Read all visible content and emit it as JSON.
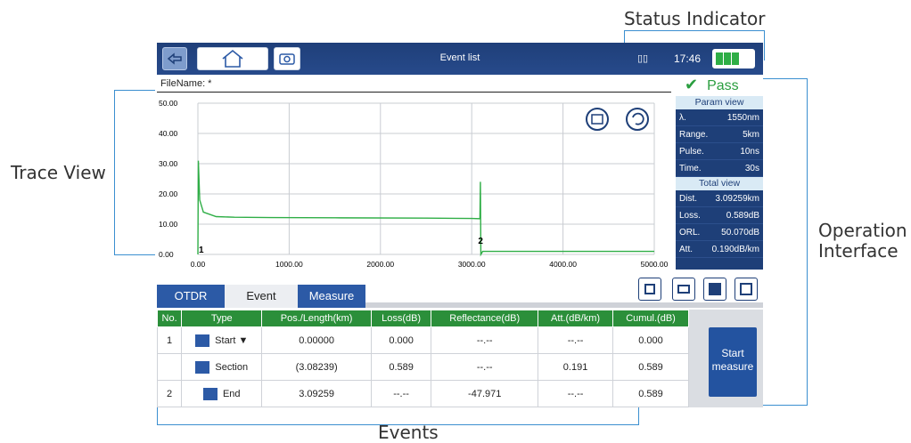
{
  "callouts": {
    "status": "Status Indicator",
    "trace": "Trace View",
    "operation_1": "Operation",
    "operation_2": "Interface",
    "events": "Events"
  },
  "titlebar": {
    "title": "Event list",
    "time": "17:46"
  },
  "file": {
    "label": "FileName: *"
  },
  "result": {
    "label": "Pass",
    "color": "#2a9e3f"
  },
  "chart_data": {
    "type": "line",
    "xlim": [
      0,
      5000
    ],
    "ylim": [
      0,
      50
    ],
    "x_ticks": [
      "0.00",
      "1000.00",
      "2000.00",
      "3000.00",
      "4000.00",
      "5000.00"
    ],
    "y_ticks": [
      "50.00",
      "40.00",
      "30.00",
      "20.00",
      "10.00",
      "0.00"
    ],
    "series": [
      {
        "values_x": [
          0,
          5,
          20,
          60,
          200,
          400,
          800,
          1500,
          2500,
          3000,
          3090,
          3095,
          3100,
          3120,
          5000
        ],
        "values_y": [
          0,
          31,
          18,
          14,
          12.5,
          12.3,
          12.2,
          12.1,
          12.0,
          11.9,
          11.8,
          24,
          0,
          1,
          1
        ]
      }
    ],
    "markers": [
      "1",
      "2"
    ]
  },
  "params": {
    "title": "Param view",
    "rows": [
      {
        "k": "λ.",
        "v": "1550nm"
      },
      {
        "k": "Range.",
        "v": "5km"
      },
      {
        "k": "Pulse.",
        "v": "10ns"
      },
      {
        "k": "Time.",
        "v": "30s"
      }
    ]
  },
  "totals": {
    "title": "Total view",
    "rows": [
      {
        "k": "Dist.",
        "v": "3.09259km"
      },
      {
        "k": "Loss.",
        "v": "0.589dB"
      },
      {
        "k": "ORL.",
        "v": "50.070dB"
      },
      {
        "k": "Att.",
        "v": "0.190dB/km"
      }
    ]
  },
  "tabs": {
    "otdr": "OTDR",
    "event": "Event",
    "measure": "Measure"
  },
  "table": {
    "headers": [
      "No.",
      "Type",
      "Pos./Length(km)",
      "Loss(dB)",
      "Reflectance(dB)",
      "Att.(dB/km)",
      "Cumul.(dB)"
    ],
    "rows": [
      [
        "1",
        "Start ▼",
        "0.00000",
        "0.000",
        "--.--",
        "--.--",
        "0.000"
      ],
      [
        "",
        "Section",
        "(3.08239)",
        "0.589",
        "--.--",
        "0.191",
        "0.589"
      ],
      [
        "2",
        "End",
        "3.09259",
        "--.--",
        "-47.971",
        "--.--",
        "0.589"
      ]
    ]
  },
  "start": {
    "line1": "Start",
    "line2": "measure"
  }
}
